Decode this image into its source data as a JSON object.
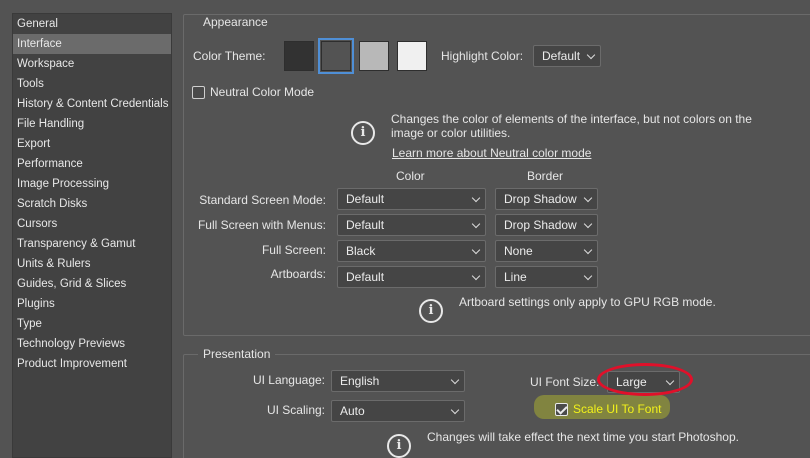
{
  "sidebar": {
    "items": [
      {
        "label": "General",
        "selected": false
      },
      {
        "label": "Interface",
        "selected": true
      },
      {
        "label": "Workspace",
        "selected": false
      },
      {
        "label": "Tools",
        "selected": false
      },
      {
        "label": "History & Content Credentials",
        "selected": false
      },
      {
        "label": "File Handling",
        "selected": false
      },
      {
        "label": "Export",
        "selected": false
      },
      {
        "label": "Performance",
        "selected": false
      },
      {
        "label": "Image Processing",
        "selected": false
      },
      {
        "label": "Scratch Disks",
        "selected": false
      },
      {
        "label": "Cursors",
        "selected": false
      },
      {
        "label": "Transparency & Gamut",
        "selected": false
      },
      {
        "label": "Units & Rulers",
        "selected": false
      },
      {
        "label": "Guides, Grid & Slices",
        "selected": false
      },
      {
        "label": "Plugins",
        "selected": false
      },
      {
        "label": "Type",
        "selected": false
      },
      {
        "label": "Technology Previews",
        "selected": false
      },
      {
        "label": "Product Improvement",
        "selected": false
      }
    ]
  },
  "appearance": {
    "title": "Appearance",
    "color_theme_label": "Color Theme:",
    "swatch_colors": [
      "#323232",
      "#535353",
      "#b8b8b8",
      "#f0f0f0"
    ],
    "selected_swatch_index": 1,
    "highlight_color_label": "Highlight Color:",
    "highlight_color_value": "Default",
    "neutral_mode_label": "Neutral Color Mode",
    "neutral_mode_checked": false,
    "neutral_note_line1": "Changes the color of elements of the interface, but not colors on the",
    "neutral_note_line2": "image or color utilities.",
    "neutral_link": "Learn more about Neutral color mode",
    "col_color": "Color",
    "col_border": "Border",
    "rows": [
      {
        "label": "Standard Screen Mode:",
        "color": "Default",
        "border": "Drop Shadow"
      },
      {
        "label": "Full Screen with Menus:",
        "color": "Default",
        "border": "Drop Shadow"
      },
      {
        "label": "Full Screen:",
        "color": "Black",
        "border": "None"
      },
      {
        "label": "Artboards:",
        "color": "Default",
        "border": "Line"
      }
    ],
    "artboard_note": "Artboard settings only apply to GPU RGB mode."
  },
  "presentation": {
    "title": "Presentation",
    "ui_language_label": "UI Language:",
    "ui_language_value": "English",
    "ui_font_size_label": "UI Font Size:",
    "ui_font_size_value": "Large",
    "ui_scaling_label": "UI Scaling:",
    "ui_scaling_value": "Auto",
    "scale_ui_label": "Scale UI To Font",
    "scale_ui_checked": true,
    "restart_note": "Changes will take effect the next time you start Photoshop."
  },
  "colors": {
    "window_bg": "#535353",
    "accent_blue": "#4f8fd6",
    "link_blue": "#6ea8ff",
    "annotation_red": "#e0102a",
    "annotation_yellow": "#d6e01e",
    "scale_label_yellow": "#f2f21a"
  }
}
